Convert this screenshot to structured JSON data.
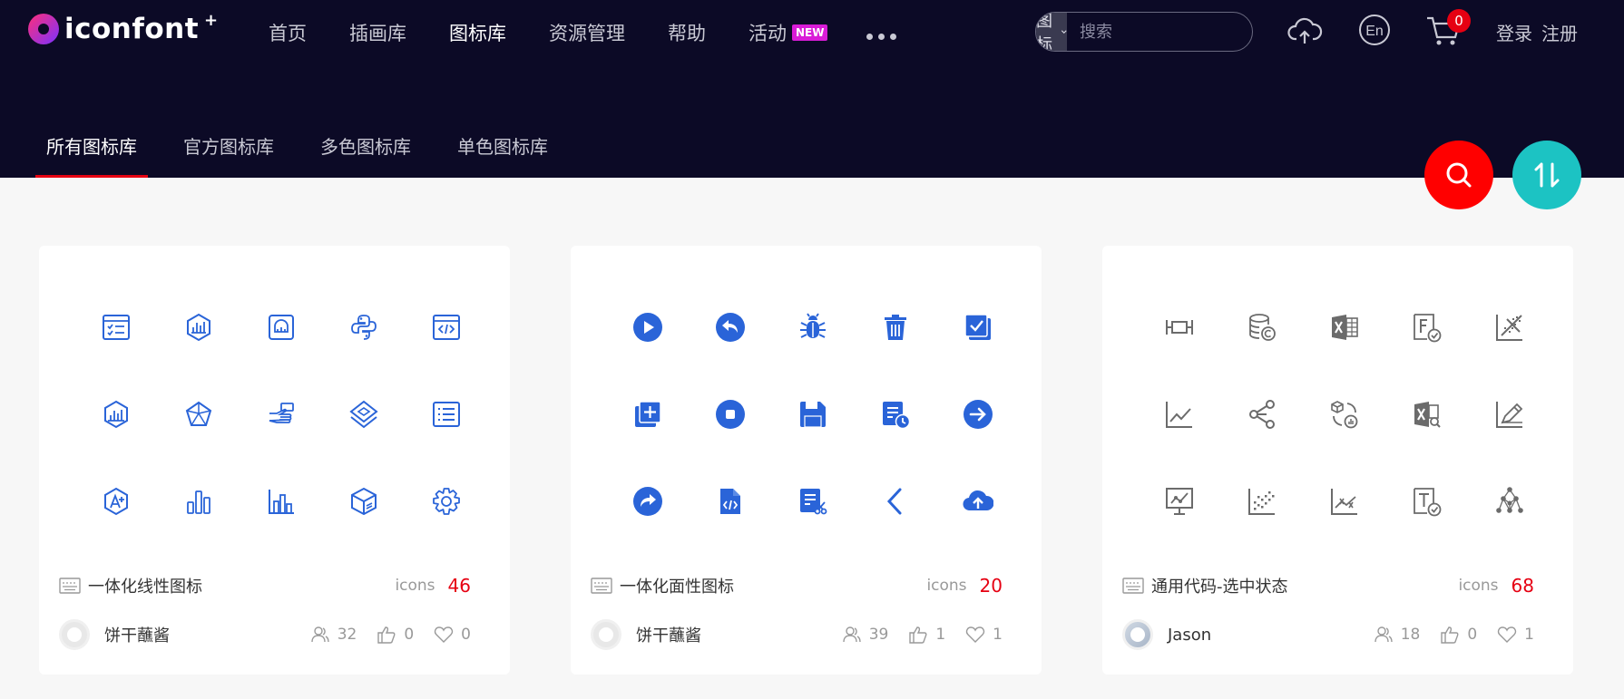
{
  "header": {
    "logo_text": "iconfont",
    "logo_plus": "+",
    "nav": [
      {
        "label": "首页"
      },
      {
        "label": "插画库"
      },
      {
        "label": "图标库",
        "active": true
      },
      {
        "label": "资源管理"
      },
      {
        "label": "帮助"
      },
      {
        "label": "活动",
        "badge": "NEW"
      }
    ],
    "search": {
      "type": "图标",
      "placeholder": "搜索"
    },
    "cart_count": "0",
    "login": "登录",
    "register": "注册"
  },
  "tabs": [
    {
      "label": "所有图标库",
      "active": true
    },
    {
      "label": "官方图标库"
    },
    {
      "label": "多色图标库"
    },
    {
      "label": "单色图标库"
    }
  ],
  "cards": [
    {
      "title": "一体化线性图标",
      "icons_label": "icons",
      "count": "46",
      "author": "饼干蘸酱",
      "followers": "32",
      "likes": "0",
      "favorites": "0",
      "style": "outline"
    },
    {
      "title": "一体化面性图标",
      "icons_label": "icons",
      "count": "20",
      "author": "饼干蘸酱",
      "followers": "39",
      "likes": "1",
      "favorites": "1",
      "style": "filled"
    },
    {
      "title": "通用代码-选中状态",
      "icons_label": "icons",
      "count": "68",
      "author": "Jason",
      "followers": "18",
      "likes": "0",
      "favorites": "1",
      "style": "gray"
    }
  ],
  "colors": {
    "header_bg": "#0c0a26",
    "accent": "#e60012",
    "icon_blue": "#2a64d8",
    "icon_gray": "#6b6b6b",
    "teal": "#1cc3c3"
  }
}
